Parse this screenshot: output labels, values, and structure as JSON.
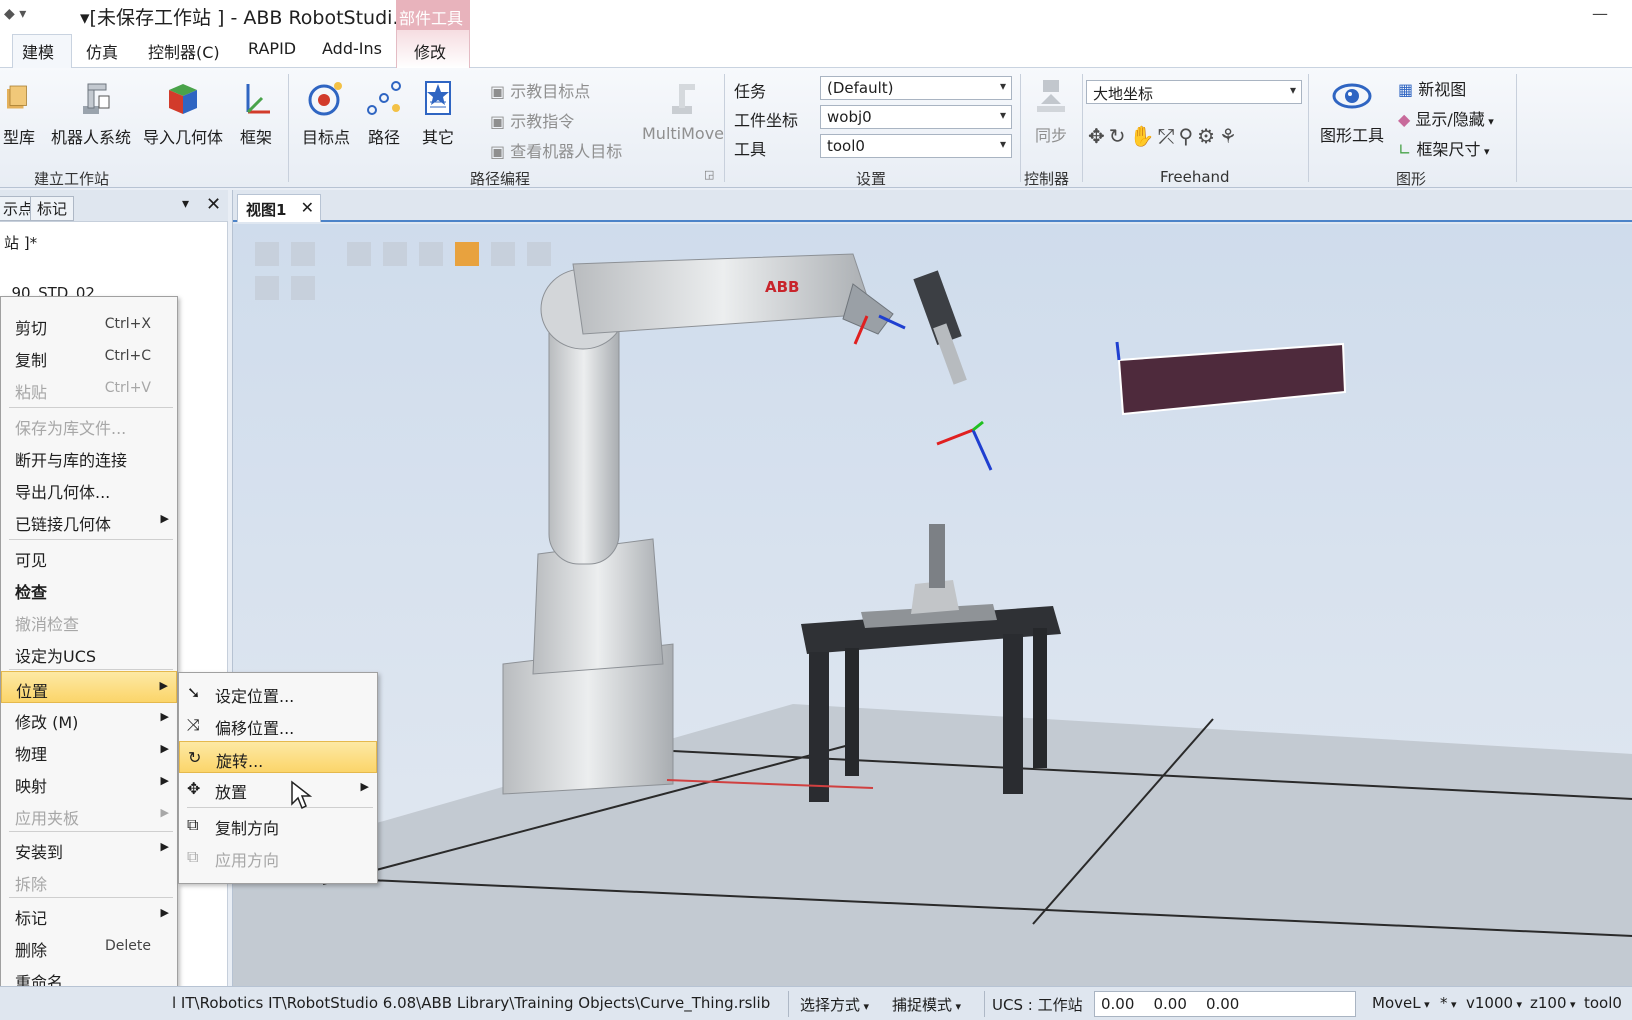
{
  "window": {
    "title": "▾[未保存工作站 ] - ABB RobotStudi...",
    "context_tab_group": "部件工具"
  },
  "tabs": [
    "建模",
    "仿真",
    "控制器(C)",
    "RAPID",
    "Add-Ins",
    "修改"
  ],
  "ribbon": {
    "build_station": {
      "label": "建立工作站",
      "buttons": [
        "型库",
        "机器人系统",
        "导入几何体",
        "框架"
      ]
    },
    "path_programming": {
      "label": "路径编程",
      "buttons": [
        "目标点",
        "路径",
        "其它"
      ],
      "small": [
        "示教目标点",
        "示教指令",
        "查看机器人目标"
      ],
      "multimove": "MultiMove"
    },
    "settings": {
      "label": "设置",
      "task_label": "任务",
      "task_value": "(Default)",
      "wobj_label": "工件坐标",
      "wobj_value": "wobj0",
      "tool_label": "工具",
      "tool_value": "tool0"
    },
    "controller": {
      "label": "控制器",
      "sync": "同步"
    },
    "freehand": {
      "label": "Freehand",
      "coord": "大地坐标"
    },
    "graphics": {
      "label": "图形",
      "graphics_tools": "图形工具",
      "new_view": "新视图",
      "show_hide": "显示/隐藏",
      "frame_size": "框架尺寸"
    }
  },
  "left_panel": {
    "tabs": [
      "示点",
      "标记"
    ],
    "tree": [
      "站 ]*",
      "_90_STD_02"
    ]
  },
  "viewport": {
    "tab": "视图1",
    "robot_logo": "ABB",
    "axis_x": "X",
    "axis_y": "Y"
  },
  "context_menu": {
    "items": [
      {
        "label": "剪切",
        "shortcut": "Ctrl+X"
      },
      {
        "label": "复制",
        "shortcut": "Ctrl+C"
      },
      {
        "label": "粘贴",
        "shortcut": "Ctrl+V"
      },
      {
        "label": "保存为库文件..."
      },
      {
        "label": "断开与库的连接"
      },
      {
        "label": "导出几何体..."
      },
      {
        "label": "已链接几何体"
      },
      {
        "label": "可见"
      },
      {
        "label": "检查"
      },
      {
        "label": "撤消检查"
      },
      {
        "label": "设定为UCS"
      },
      {
        "label": "位置"
      },
      {
        "label": "修改 (M)"
      },
      {
        "label": "物理"
      },
      {
        "label": "映射"
      },
      {
        "label": "应用夹板"
      },
      {
        "label": "安装到"
      },
      {
        "label": "拆除"
      },
      {
        "label": "标记"
      },
      {
        "label": "删除",
        "shortcut": "Delete"
      },
      {
        "label": "重命名"
      }
    ]
  },
  "position_submenu": {
    "items": [
      "设定位置...",
      "偏移位置...",
      "旋转...",
      "放置",
      "复制方向",
      "应用方向"
    ]
  },
  "status_bar": {
    "path": "l IT\\Robotics IT\\RobotStudio 6.08\\ABB Library\\Training Objects\\Curve_Thing.rslib",
    "select_mode": "选择方式",
    "snap_mode": "捕捉模式",
    "ucs": "UCS : 工作站",
    "coords": "0.00    0.00    0.00",
    "instr": "MoveL",
    "star": "*",
    "speed": "v1000",
    "zone": "z100",
    "tool": "tool0"
  },
  "colors": {
    "accent": "#4c83c8",
    "menu_highlight": "#fbd56a",
    "context_tab": "#e8b3bc",
    "part": "#4e2a3c"
  }
}
